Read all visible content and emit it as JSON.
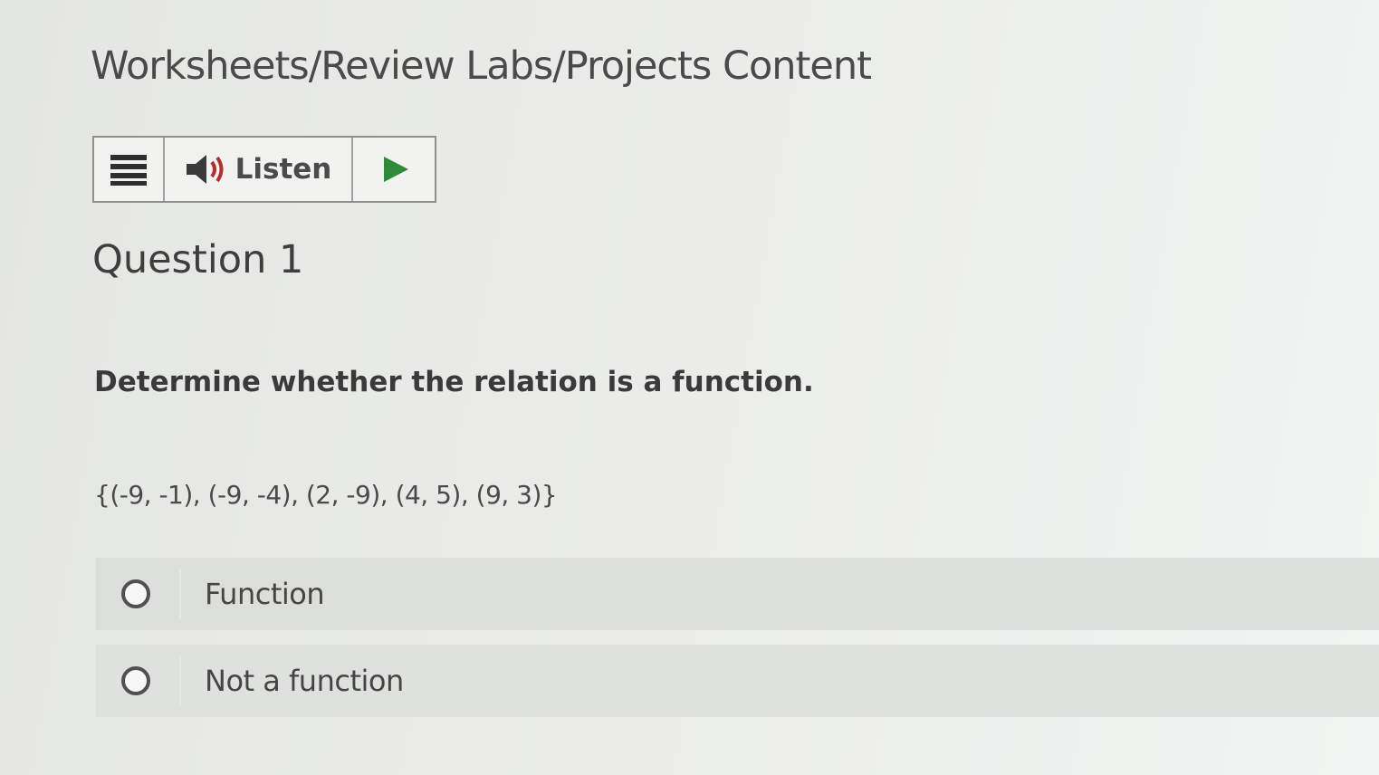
{
  "header": {
    "title": "Worksheets/Review Labs/Projects Content"
  },
  "toolbar": {
    "menu_icon": "hamburger-menu-icon",
    "speaker_icon": "speaker-icon",
    "listen_label": "Listen",
    "play_icon": "play-icon",
    "play_color": "#2e8b3a",
    "speaker_color": "#3a3a3a",
    "speaker_wave_color": "#b03030"
  },
  "question": {
    "title": "Question 1",
    "prompt": "Determine whether the relation is a function.",
    "relation": "{(-9, -1), (-9, -4), (2, -9), (4, 5), (9, 3)}",
    "options": [
      {
        "label": "Function",
        "selected": false
      },
      {
        "label": "Not a function",
        "selected": false
      }
    ]
  }
}
